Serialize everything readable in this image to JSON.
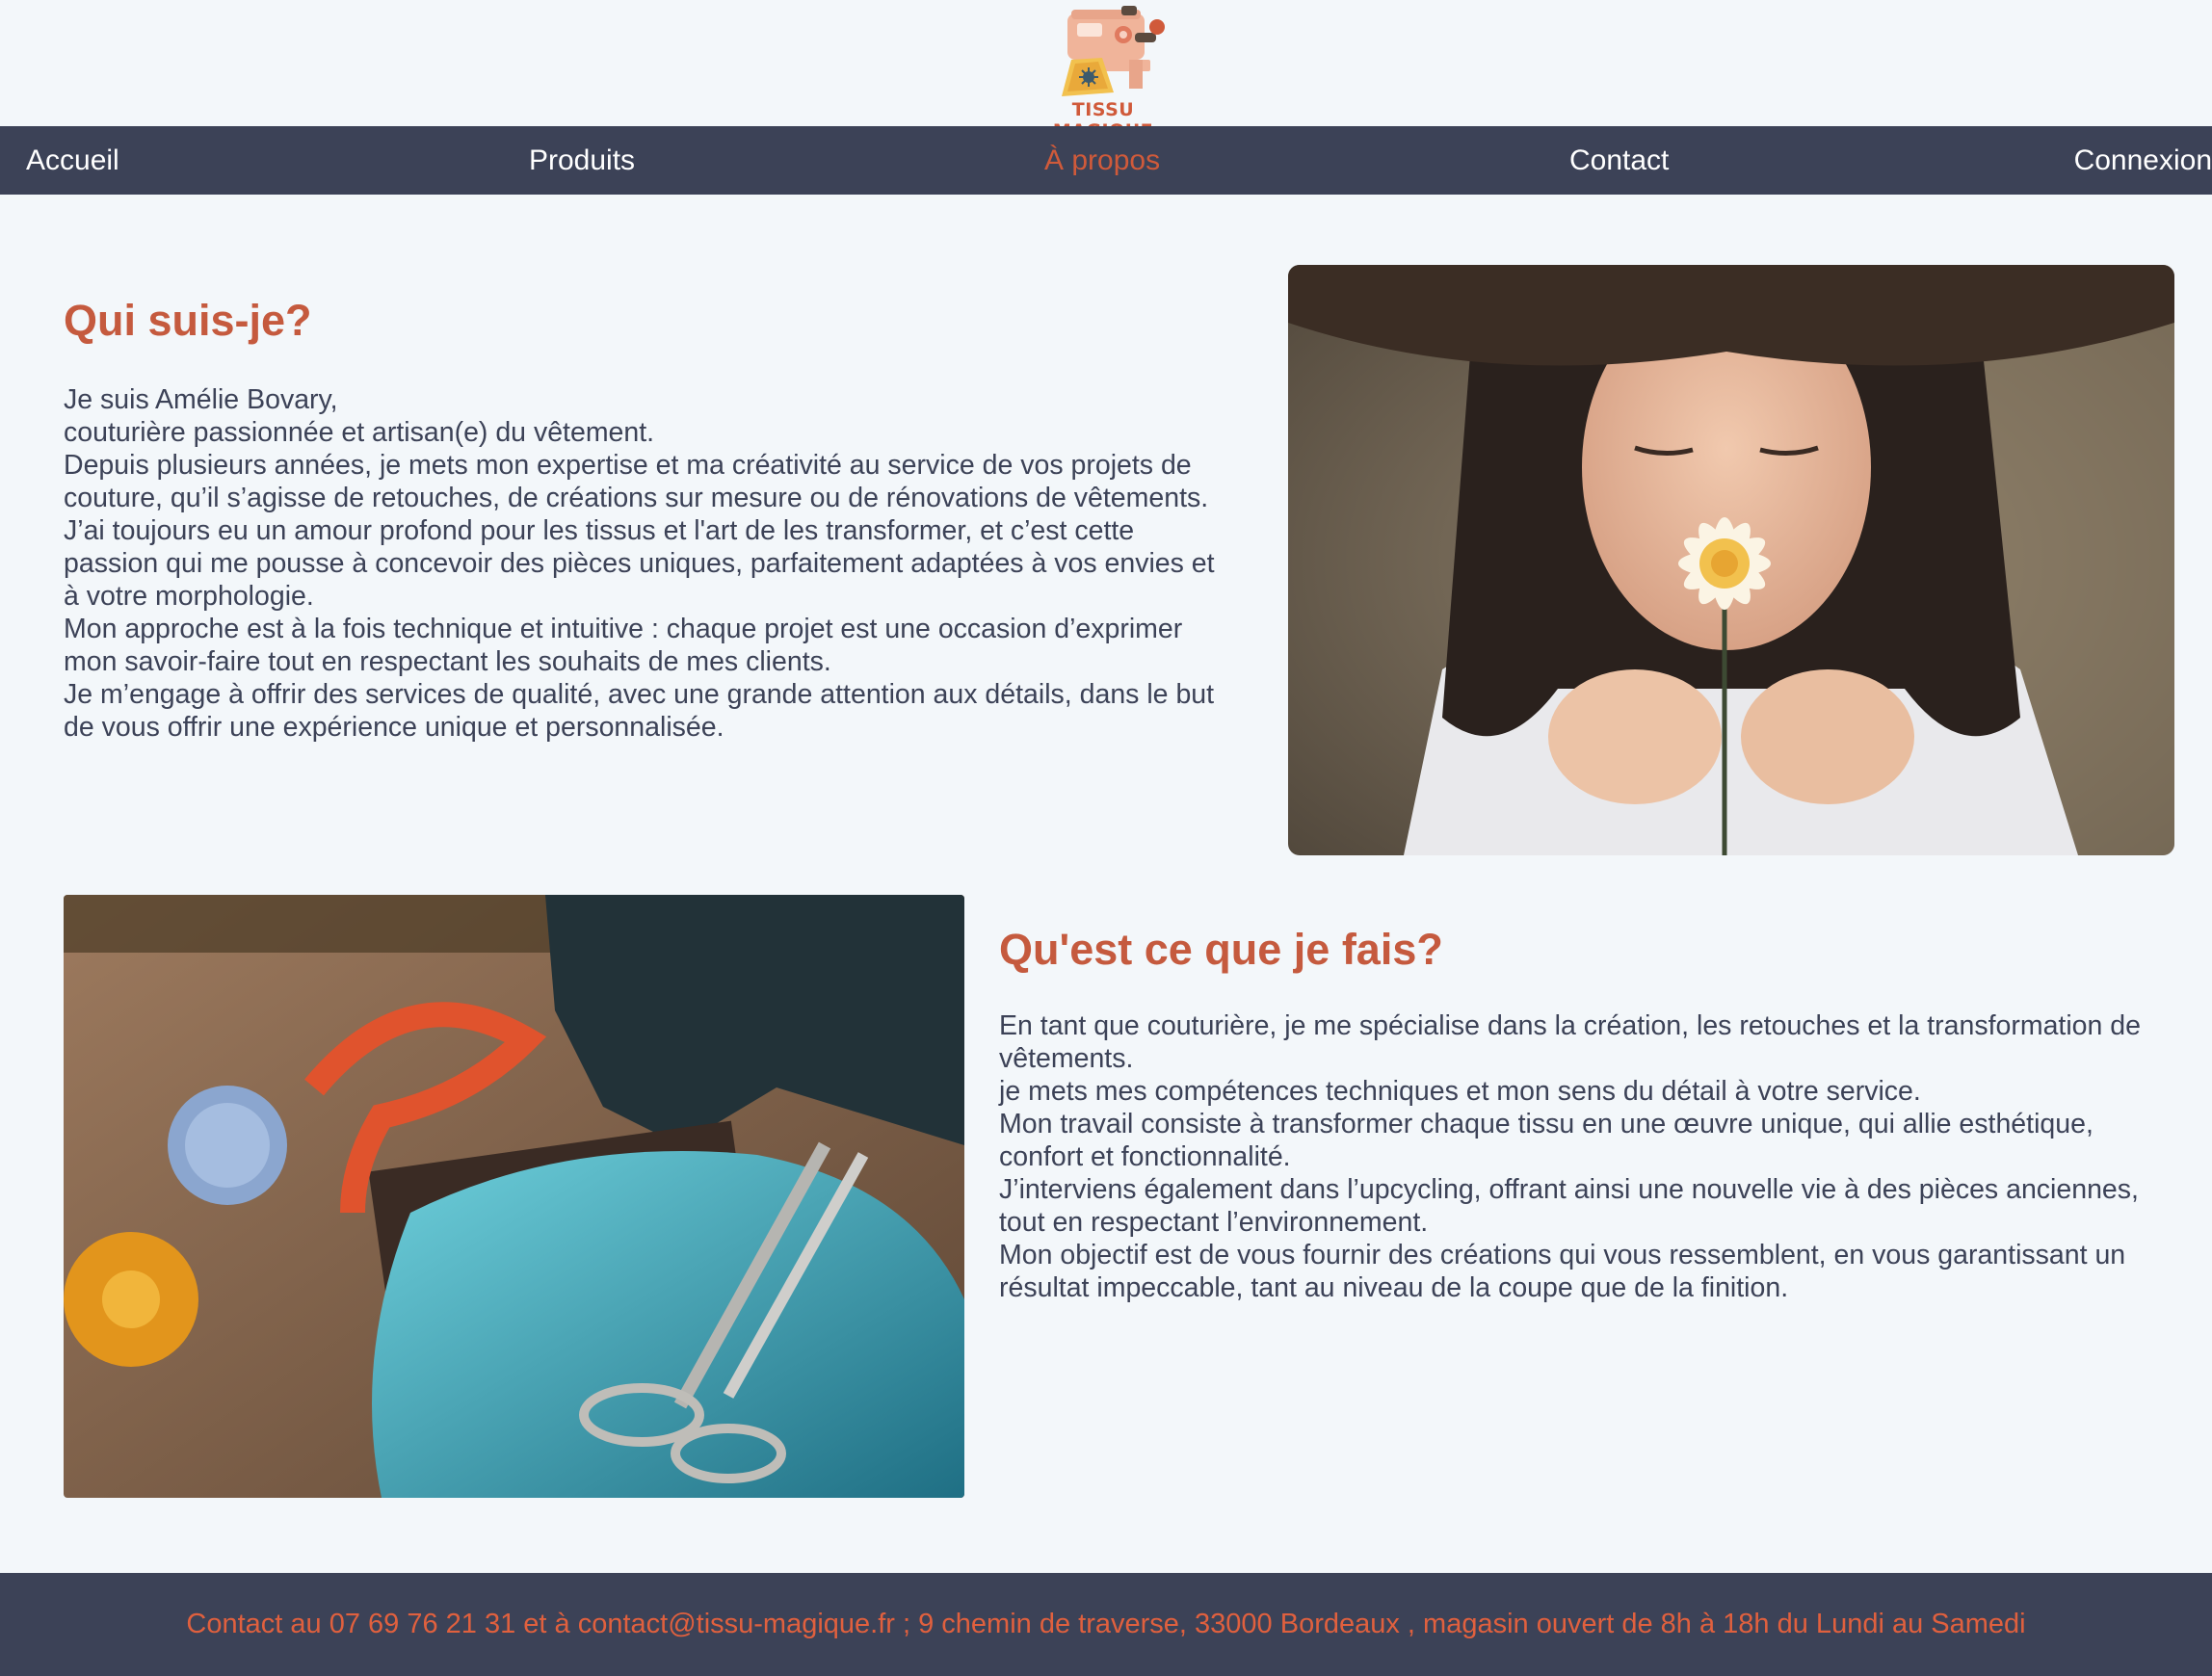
{
  "logo": {
    "text": "TISSU MAGIQUE",
    "icon": "sewing-machine-icon"
  },
  "nav": {
    "items": [
      {
        "label": "Accueil"
      },
      {
        "label": "Produits"
      },
      {
        "label": "À propos",
        "active": true
      },
      {
        "label": "Contact"
      },
      {
        "label": "Connexion"
      }
    ]
  },
  "section_about": {
    "title": "Qui suis-je?",
    "lines": [
      "Je suis Amélie Bovary,",
      "couturière passionnée et artisan(e) du vêtement.",
      "Depuis plusieurs années, je mets mon expertise et ma créativité au service de vos projets de",
      "couture, qu’il s’agisse de retouches, de créations sur mesure ou de rénovations de vêtements.",
      "J’ai toujours eu un amour profond pour les tissus et l'art de les transformer, et c’est cette",
      "passion qui me pousse à concevoir des pièces uniques, parfaitement adaptées à vos envies et",
      "à votre morphologie.",
      "Mon approche est à la fois technique et intuitive : chaque projet est une occasion d’exprimer",
      "mon savoir-faire tout en respectant les souhaits de mes clients.",
      "Je m’engage à offrir des services de qualité, avec une grande attention aux détails, dans le but",
      "de vous offrir une expérience unique et personnalisée."
    ]
  },
  "section_work": {
    "title": "Qu'est ce que je fais?",
    "lines": [
      "En tant que couturière, je me spécialise dans la création, les retouches et la transformation de",
      "vêtements.",
      "je mets mes compétences techniques et mon sens du détail à votre service.",
      "Mon travail consiste à transformer chaque tissu en une œuvre unique, qui allie esthétique,",
      "confort et fonctionnalité.",
      "J’interviens également dans l’upcycling, offrant ainsi une nouvelle vie à des pièces anciennes,",
      "tout en respectant l’environnement.",
      "Mon objectif est de vous fournir des créations qui vous ressemblent, en vous garantissant un",
      "résultat impeccable, tant au niveau de la coupe que de la finition."
    ]
  },
  "footer": {
    "text": "Contact au 07 69 76 21 31 et à contact@tissu-magique.fr ; 9 chemin de traverse, 33000 Bordeaux , magasin ouvert de 8h à 18h du Lundi au Samedi"
  },
  "colors": {
    "nav_bg": "#3c4257",
    "accent": "#c55a3e",
    "page_bg": "#f3f7fa"
  }
}
